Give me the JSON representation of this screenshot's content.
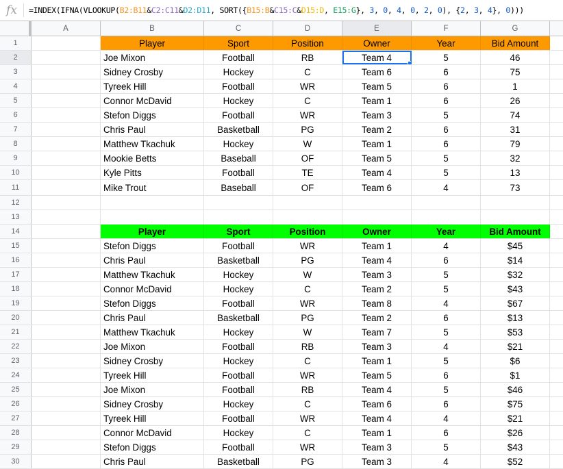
{
  "formula_bar": {
    "icon": "fx-icon",
    "segments": [
      {
        "text": "=INDEX(IFNA(VLOOKUP(",
        "color": "#000000"
      },
      {
        "text": "B2:B11",
        "color": "#f6921e"
      },
      {
        "text": "&",
        "color": "#000000"
      },
      {
        "text": "C2:C11",
        "color": "#8e67c0"
      },
      {
        "text": "&",
        "color": "#000000"
      },
      {
        "text": "D2:D11",
        "color": "#2ca6c9"
      },
      {
        "text": ", SORT({",
        "color": "#000000"
      },
      {
        "text": "B15:B",
        "color": "#f6921e"
      },
      {
        "text": "&",
        "color": "#000000"
      },
      {
        "text": "C15:C",
        "color": "#8e67c0"
      },
      {
        "text": "&",
        "color": "#000000"
      },
      {
        "text": "D15:D",
        "color": "#f4b400"
      },
      {
        "text": ", ",
        "color": "#000000"
      },
      {
        "text": "E15:G",
        "color": "#0f9d58"
      },
      {
        "text": "}, ",
        "color": "#000000"
      },
      {
        "text": "3",
        "color": "#1155cc"
      },
      {
        "text": ", ",
        "color": "#000000"
      },
      {
        "text": "0",
        "color": "#1155cc"
      },
      {
        "text": ", ",
        "color": "#000000"
      },
      {
        "text": "4",
        "color": "#1155cc"
      },
      {
        "text": ", ",
        "color": "#000000"
      },
      {
        "text": "0",
        "color": "#1155cc"
      },
      {
        "text": ", ",
        "color": "#000000"
      },
      {
        "text": "2",
        "color": "#1155cc"
      },
      {
        "text": ", ",
        "color": "#000000"
      },
      {
        "text": "0",
        "color": "#1155cc"
      },
      {
        "text": "), {",
        "color": "#000000"
      },
      {
        "text": "2",
        "color": "#1155cc"
      },
      {
        "text": ", ",
        "color": "#000000"
      },
      {
        "text": "3",
        "color": "#1155cc"
      },
      {
        "text": ", ",
        "color": "#000000"
      },
      {
        "text": "4",
        "color": "#1155cc"
      },
      {
        "text": "}, ",
        "color": "#000000"
      },
      {
        "text": "0",
        "color": "#1155cc"
      },
      {
        "text": ")))",
        "color": "#000000"
      }
    ]
  },
  "columns": [
    "A",
    "B",
    "C",
    "D",
    "E",
    "F",
    "G"
  ],
  "selected_column": "E",
  "selected_row": "2",
  "selected_cell": "E2",
  "header_colors": {
    "table1": "#ff9900",
    "table2": "#00ff00"
  },
  "rows": [
    {
      "num": "1",
      "type": "header1",
      "cells": [
        "Player",
        "Sport",
        "Position",
        "Owner",
        "Year",
        "Bid Amount"
      ]
    },
    {
      "num": "2",
      "type": "data",
      "cells": [
        "Joe Mixon",
        "Football",
        "RB",
        "Team 4",
        "5",
        "46"
      ]
    },
    {
      "num": "3",
      "type": "data",
      "cells": [
        "Sidney Crosby",
        "Hockey",
        "C",
        "Team 6",
        "6",
        "75"
      ]
    },
    {
      "num": "4",
      "type": "data",
      "cells": [
        "Tyreek Hill",
        "Football",
        "WR",
        "Team 5",
        "6",
        "1"
      ]
    },
    {
      "num": "5",
      "type": "data",
      "cells": [
        "Connor McDavid",
        "Hockey",
        "C",
        "Team 1",
        "6",
        "26"
      ]
    },
    {
      "num": "6",
      "type": "data",
      "cells": [
        "Stefon Diggs",
        "Football",
        "WR",
        "Team 3",
        "5",
        "74"
      ]
    },
    {
      "num": "7",
      "type": "data",
      "cells": [
        "Chris Paul",
        "Basketball",
        "PG",
        "Team 2",
        "6",
        "31"
      ]
    },
    {
      "num": "8",
      "type": "data",
      "cells": [
        "Matthew Tkachuk",
        "Hockey",
        "W",
        "Team 1",
        "6",
        "79"
      ]
    },
    {
      "num": "9",
      "type": "data",
      "cells": [
        "Mookie Betts",
        "Baseball",
        "OF",
        "Team 5",
        "5",
        "32"
      ]
    },
    {
      "num": "10",
      "type": "data",
      "cells": [
        "Kyle Pitts",
        "Football",
        "TE",
        "Team 4",
        "5",
        "13"
      ]
    },
    {
      "num": "11",
      "type": "data-tall",
      "cells": [
        "Mike Trout",
        "Baseball",
        "OF",
        "Team 6",
        "4",
        "73"
      ]
    },
    {
      "num": "12",
      "type": "empty",
      "cells": [
        "",
        "",
        "",
        "",
        "",
        ""
      ]
    },
    {
      "num": "13",
      "type": "empty",
      "cells": [
        "",
        "",
        "",
        "",
        "",
        ""
      ]
    },
    {
      "num": "14",
      "type": "header2",
      "cells": [
        "Player",
        "Sport",
        "Position",
        "Owner",
        "Year",
        "Bid Amount"
      ]
    },
    {
      "num": "15",
      "type": "data",
      "cells": [
        "Stefon Diggs",
        "Football",
        "WR",
        "Team 1",
        "4",
        "$45"
      ]
    },
    {
      "num": "16",
      "type": "data",
      "cells": [
        "Chris Paul",
        "Basketball",
        "PG",
        "Team 4",
        "6",
        "$14"
      ]
    },
    {
      "num": "17",
      "type": "data",
      "cells": [
        "Matthew Tkachuk",
        "Hockey",
        "W",
        "Team 3",
        "5",
        "$32"
      ]
    },
    {
      "num": "18",
      "type": "data",
      "cells": [
        "Connor McDavid",
        "Hockey",
        "C",
        "Team 2",
        "5",
        "$43"
      ]
    },
    {
      "num": "19",
      "type": "data",
      "cells": [
        "Stefon Diggs",
        "Football",
        "WR",
        "Team 8",
        "4",
        "$67"
      ]
    },
    {
      "num": "20",
      "type": "data",
      "cells": [
        "Chris Paul",
        "Basketball",
        "PG",
        "Team 2",
        "6",
        "$13"
      ]
    },
    {
      "num": "21",
      "type": "data",
      "cells": [
        "Matthew Tkachuk",
        "Hockey",
        "W",
        "Team 7",
        "5",
        "$53"
      ]
    },
    {
      "num": "22",
      "type": "data",
      "cells": [
        "Joe Mixon",
        "Football",
        "RB",
        "Team 3",
        "4",
        "$21"
      ]
    },
    {
      "num": "23",
      "type": "data",
      "cells": [
        "Sidney Crosby",
        "Hockey",
        "C",
        "Team 1",
        "5",
        "$6"
      ]
    },
    {
      "num": "24",
      "type": "data",
      "cells": [
        "Tyreek Hill",
        "Football",
        "WR",
        "Team 5",
        "6",
        "$1"
      ]
    },
    {
      "num": "25",
      "type": "data",
      "cells": [
        "Joe Mixon",
        "Football",
        "RB",
        "Team 4",
        "5",
        "$46"
      ]
    },
    {
      "num": "26",
      "type": "data",
      "cells": [
        "Sidney Crosby",
        "Hockey",
        "C",
        "Team 6",
        "6",
        "$75"
      ]
    },
    {
      "num": "27",
      "type": "data",
      "cells": [
        "Tyreek Hill",
        "Football",
        "WR",
        "Team 4",
        "4",
        "$21"
      ]
    },
    {
      "num": "28",
      "type": "data",
      "cells": [
        "Connor McDavid",
        "Hockey",
        "C",
        "Team 1",
        "6",
        "$26"
      ]
    },
    {
      "num": "29",
      "type": "data",
      "cells": [
        "Stefon Diggs",
        "Football",
        "WR",
        "Team 3",
        "5",
        "$43"
      ]
    },
    {
      "num": "30",
      "type": "data",
      "cells": [
        "Chris Paul",
        "Basketball",
        "PG",
        "Team 3",
        "4",
        "$52"
      ]
    }
  ]
}
